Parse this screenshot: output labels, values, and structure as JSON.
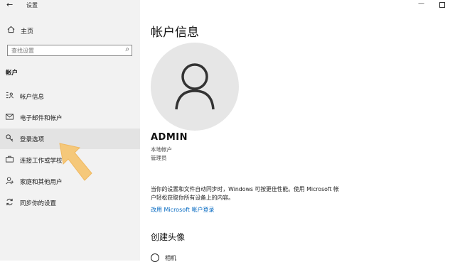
{
  "window": {
    "title": "设置"
  },
  "sidebar": {
    "home_label": "主页",
    "search_placeholder": "查找设置",
    "section_label": "帐户",
    "items": [
      {
        "label": "帐户信息",
        "icon": "person-card-icon"
      },
      {
        "label": "电子邮件和帐户",
        "icon": "mail-icon"
      },
      {
        "label": "登录选项",
        "icon": "key-icon",
        "selected": true
      },
      {
        "label": "连接工作或学校",
        "icon": "briefcase-icon"
      },
      {
        "label": "家庭和其他用户",
        "icon": "add-person-icon"
      },
      {
        "label": "同步你的设置",
        "icon": "sync-icon"
      }
    ]
  },
  "main": {
    "title": "帐户信息",
    "user": {
      "name": "ADMIN",
      "type": "本地帐户",
      "role": "管理员"
    },
    "description": "当你的设置和文件自动同步时，Windows 可按更佳性能。使用 Microsoft 帐户轻松获取你所有设备上的内容。",
    "link": "改用 Microsoft 帐户登录",
    "create_heading": "创建头像",
    "camera_label": "相机"
  },
  "colors": {
    "accent": "#0067c0",
    "sidebar_bg": "#f2f2f2",
    "arrow": "#f5c87a"
  }
}
